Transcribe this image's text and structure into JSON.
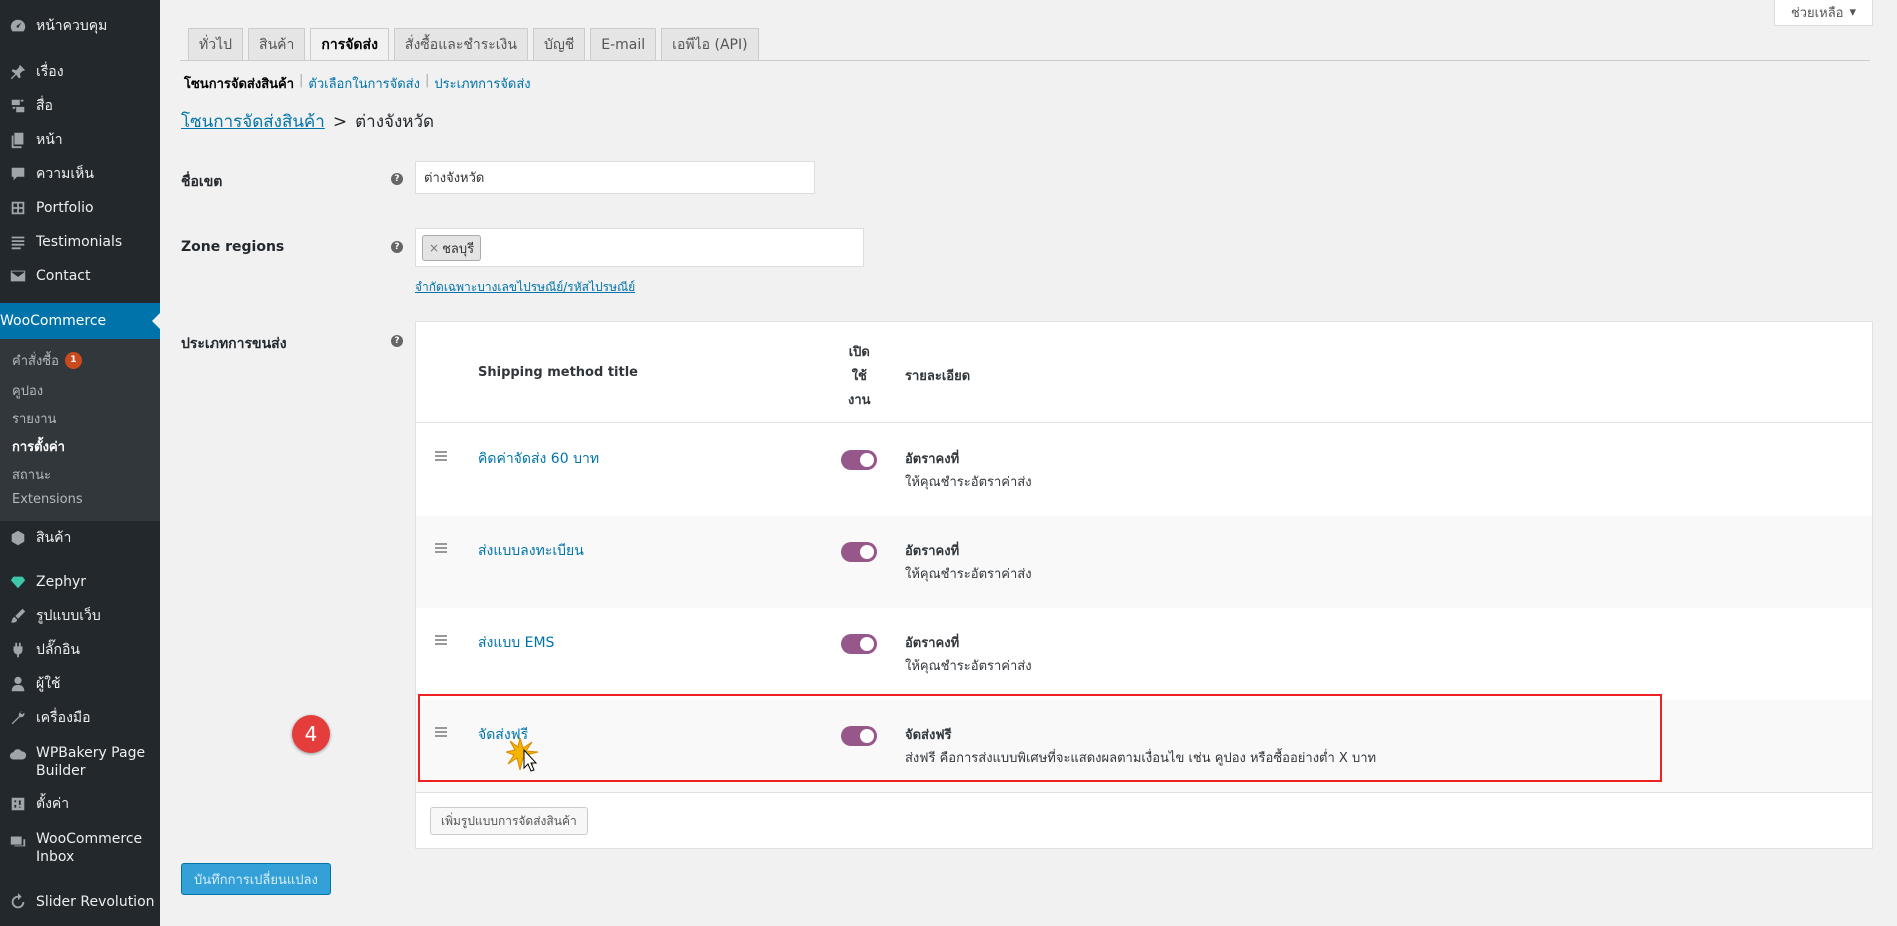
{
  "sidebar": {
    "items": [
      {
        "label": "หน้าควบคุม",
        "icon": "dashboard-icon"
      },
      {
        "label": "เรื่อง",
        "icon": "pin-icon"
      },
      {
        "label": "สื่อ",
        "icon": "media-icon"
      },
      {
        "label": "หน้า",
        "icon": "page-icon"
      },
      {
        "label": "ความเห็น",
        "icon": "comment-icon"
      },
      {
        "label": "Portfolio",
        "icon": "portfolio-icon"
      },
      {
        "label": "Testimonials",
        "icon": "testimonial-icon"
      },
      {
        "label": "Contact",
        "icon": "mail-icon"
      }
    ],
    "woocommerce": {
      "label": "WooCommerce",
      "icon": "woo-icon"
    },
    "woo_sub": [
      {
        "label": "คำสั่งซื้อ",
        "badge": "1"
      },
      {
        "label": "คูปอง"
      },
      {
        "label": "รายงาน"
      },
      {
        "label": "การตั้งค่า"
      },
      {
        "label": "สถานะ"
      },
      {
        "label": "Extensions"
      }
    ],
    "lower_items": [
      {
        "label": "สินค้า",
        "icon": "product-icon"
      },
      {
        "label": "Zephyr",
        "icon": "diamond-icon"
      },
      {
        "label": "รูปแบบเว็บ",
        "icon": "brush-icon"
      },
      {
        "label": "ปลั๊กอิน",
        "icon": "plugin-icon"
      },
      {
        "label": "ผู้ใช้",
        "icon": "user-icon"
      },
      {
        "label": "เครื่องมือ",
        "icon": "wrench-icon"
      },
      {
        "label": "WPBakery Page Builder",
        "icon": "cloud-icon"
      },
      {
        "label": "ตั้งค่า",
        "icon": "settings-icon"
      },
      {
        "label": "WooCommerce Inbox",
        "icon": "inbox-icon"
      },
      {
        "label": "Slider Revolution",
        "icon": "refresh-icon"
      }
    ]
  },
  "help_tab": "ช่วยเหลือ",
  "tabs": [
    "ทั่วไป",
    "สินค้า",
    "การจัดส่ง",
    "สั่งซื้อและชำระเงิน",
    "บัญชี",
    "E-mail",
    "เอพีไอ (API)"
  ],
  "subsub": {
    "current": "โซนการจัดส่งสินค้า",
    "link1": "ตัวเลือกในการจัดส่ง",
    "link2": "ประเภทการจัดส่ง",
    "sep": "|"
  },
  "breadcrumb": {
    "parent": "โซนการจัดส่งสินค้า",
    "sep": ">",
    "current": "ต่างจังหวัด"
  },
  "form": {
    "zone_name_label": "ชื่อเขต",
    "zone_name_value": "ต่างจังหวัด",
    "zone_regions_label": "Zone regions",
    "region_chip": "ชลบุรี",
    "region_remove": "×",
    "postcode_link": "จำกัดเฉพาะบางเลขไปรษณีย์/รหัสไปรษณีย์",
    "methods_label": "ประเภทการขนส่ง",
    "help_mark": "?"
  },
  "table": {
    "col_title": "Shipping method title",
    "col_enabled_1": "เปิด",
    "col_enabled_2": "ใช้",
    "col_enabled_3": "งาน",
    "col_desc": "รายละเอียด",
    "rows": [
      {
        "title": "คิดค่าจัดส่ง 60 บาท",
        "desc_title": "อัตราคงที่",
        "desc": "ให้คุณชำระอัตราค่าส่ง",
        "enabled": true
      },
      {
        "title": "ส่งแบบลงทะเบียน",
        "desc_title": "อัตราคงที่",
        "desc": "ให้คุณชำระอัตราค่าส่ง",
        "enabled": true
      },
      {
        "title": "ส่งแบบ EMS",
        "desc_title": "อัตราคงที่",
        "desc": "ให้คุณชำระอัตราค่าส่ง",
        "enabled": true
      },
      {
        "title": "จัดส่งฟรี",
        "desc_title": "จัดส่งฟรี",
        "desc": "ส่งฟรี คือการส่งแบบพิเศษที่จะแสดงผลตามเงื่อนไข เช่น คูปอง หรือซื้ออย่างต่ำ X บาท",
        "enabled": true
      }
    ],
    "add_button": "เพิ่มรูปแบบการจัดส่งสินค้า"
  },
  "step_number": "4",
  "save_button": "บันทึกการเปลี่ยนแปลง",
  "colors": {
    "sidebar_bg": "#23282d",
    "accent": "#0073aa",
    "toggle_on": "#96588a",
    "highlight": "#ee2222",
    "step_badge": "#e53c3c"
  }
}
